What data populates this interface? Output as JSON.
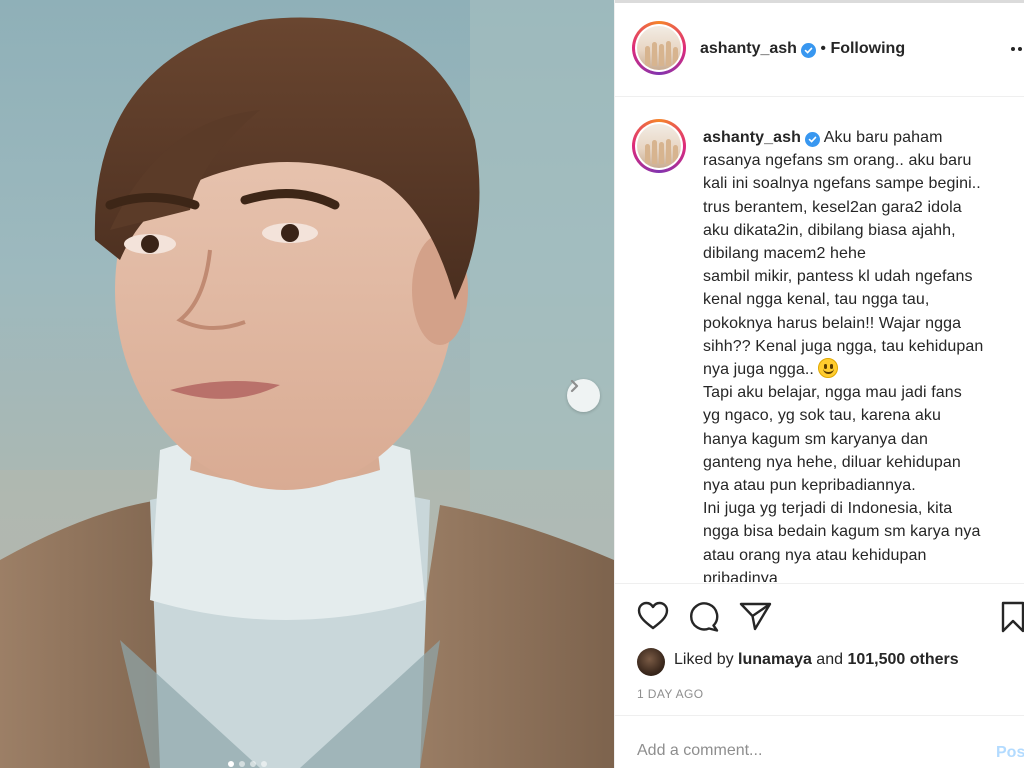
{
  "post": {
    "username": "ashanty_ash",
    "separator": " • ",
    "follow_status": "Following",
    "caption_lines": [
      "Aku baru paham",
      "rasanya ngefans sm orang.. aku baru",
      "kali ini soalnya ngefans sampe begini..",
      "trus berantem, kesel2an gara2 idola",
      "aku dikata2in, dibilang biasa ajahh,",
      "dibilang macem2 hehe",
      "sambil mikir, pantess kl udah ngefans",
      "kenal ngga kenal, tau ngga tau,",
      "pokoknya harus belain!! Wajar ngga",
      "sihh?? Kenal juga ngga, tau kehidupan",
      "nya juga ngga.. ",
      "Tapi aku belajar, ngga mau jadi fans",
      "yg ngaco, yg sok tau, karena aku",
      "hanya kagum sm karyanya dan",
      "ganteng nya hehe, diluar kehidupan",
      "nya atau pun kepribadiannya.",
      "Ini juga yg terjadi di Indonesia, kita",
      "ngga bisa bedain kagum sm karya nya",
      "atau orang nya atau kehidupan",
      "pribadinya"
    ],
    "emoji_icon": "smiling-face-emoji",
    "likes": {
      "prefix": "Liked by ",
      "user": "lunamaya",
      "middle": " and ",
      "count": "101,500 others"
    },
    "time": "1 DAY AGO",
    "comment": {
      "placeholder": "Add a comment...",
      "value": "",
      "post_label": "Post"
    },
    "carousel": {
      "total": 4,
      "active": 1
    }
  },
  "icons": {
    "heart": "heart-icon",
    "comment": "comment-icon",
    "share": "paper-plane-icon",
    "save": "bookmark-icon",
    "more": "more-options-icon",
    "verified": "verified-badge-icon",
    "next": "chevron-right-icon"
  },
  "colors": {
    "verified": "#3897f0",
    "text": "#262626",
    "muted": "#8e8e8e",
    "post_button": "#b3dbff"
  }
}
